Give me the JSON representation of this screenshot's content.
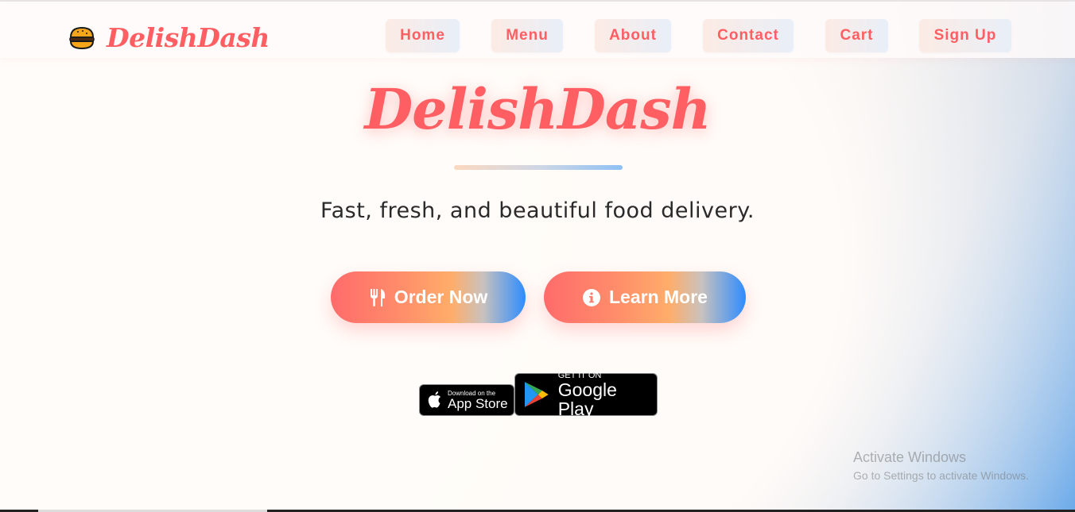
{
  "brand": {
    "name": "DelishDash"
  },
  "nav": {
    "items": [
      {
        "label": "Home"
      },
      {
        "label": "Menu"
      },
      {
        "label": "About"
      },
      {
        "label": "Contact"
      },
      {
        "label": "Cart"
      },
      {
        "label": "Sign Up"
      }
    ]
  },
  "hero": {
    "title": "DelishDash",
    "tagline": "Fast, fresh, and beautiful food delivery.",
    "primary_button": {
      "label": "Order Now",
      "icon": "utensils-icon"
    },
    "secondary_button": {
      "label": "Learn More",
      "icon": "info-circle-icon"
    }
  },
  "stores": {
    "app_store": {
      "small_text": "Download on the",
      "big_text": "App Store",
      "icon": "apple-icon"
    },
    "google_play": {
      "small_text": "GET IT ON",
      "big_text": "Google Play",
      "icon": "play-triangle-icon"
    }
  },
  "watermark": {
    "title": "Activate Windows",
    "subtitle": "Go to Settings to activate Windows."
  },
  "colors": {
    "accent": "#ff5e62",
    "gradient_start": "#ff6b6b",
    "gradient_mid": "#ffad6a",
    "gradient_end": "#2e8cff",
    "text_dark": "#2a2a2a"
  }
}
